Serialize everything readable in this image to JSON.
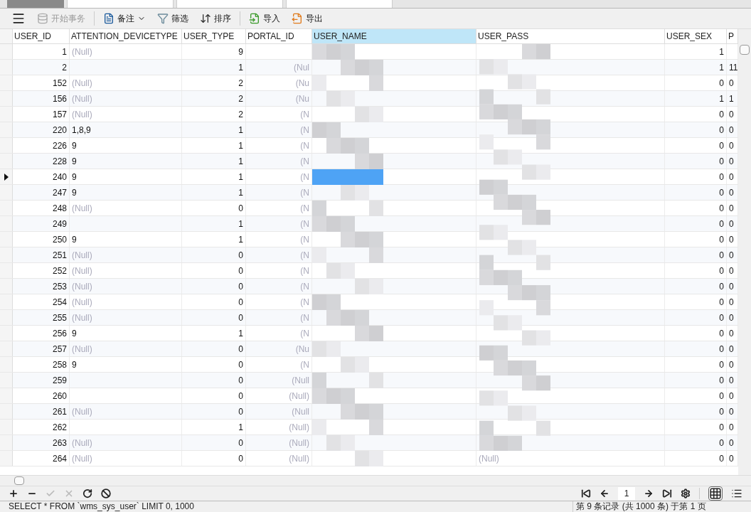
{
  "toolbar": {
    "buttons": [
      {
        "kind": "menu"
      },
      {
        "kind": "transaction",
        "label": "开始事务",
        "disabled": true
      },
      {
        "kind": "note",
        "label": "备注",
        "disabled": false
      },
      {
        "kind": "filter",
        "label": "筛选",
        "disabled": false
      },
      {
        "kind": "sort",
        "label": "排序",
        "disabled": false
      },
      {
        "kind": "import",
        "label": "导入",
        "disabled": false
      },
      {
        "kind": "export",
        "label": "导出",
        "disabled": false
      }
    ]
  },
  "table": {
    "columns": [
      {
        "label": "USER_ID",
        "kind": "number",
        "selected": false
      },
      {
        "label": "ATTENTION_DEVICETYPE",
        "kind": "text",
        "selected": false
      },
      {
        "label": "USER_TYPE",
        "kind": "number",
        "selected": false
      },
      {
        "label": "PORTAL_ID",
        "kind": "number",
        "selected": false
      },
      {
        "label": "USER_NAME",
        "kind": "text",
        "selected": true
      },
      {
        "label": "USER_PASS",
        "kind": "text",
        "selected": false
      },
      {
        "label": "USER_SEX",
        "kind": "number",
        "selected": false
      },
      {
        "label": "P",
        "kind": "text",
        "selected": false
      }
    ],
    "rows": [
      {
        "current": false,
        "cells": [
          "1",
          "(Null)",
          "9",
          "",
          "",
          "",
          "1",
          ""
        ]
      },
      {
        "current": false,
        "cells": [
          "2",
          "",
          "1",
          "(Nul",
          "",
          "",
          "1",
          "11"
        ]
      },
      {
        "current": false,
        "cells": [
          "152",
          "(Null)",
          "2",
          "(Nu",
          "",
          "",
          "0",
          "0"
        ]
      },
      {
        "current": false,
        "cells": [
          "156",
          "(Null)",
          "2",
          "(Nu",
          "",
          "",
          "1",
          "1"
        ]
      },
      {
        "current": false,
        "cells": [
          "157",
          "(Null)",
          "2",
          "(N",
          "",
          "",
          "0",
          "0"
        ]
      },
      {
        "current": false,
        "cells": [
          "220",
          "1,8,9",
          "1",
          "(N",
          "",
          "",
          "0",
          "0"
        ]
      },
      {
        "current": false,
        "cells": [
          "226",
          "9",
          "1",
          "(N",
          "",
          "",
          "0",
          "0"
        ]
      },
      {
        "current": false,
        "cells": [
          "228",
          "9",
          "1",
          "(N",
          "",
          "",
          "0",
          "0"
        ]
      },
      {
        "current": true,
        "cells": [
          "240",
          "9",
          "1",
          "(N",
          "",
          "",
          "0",
          "0"
        ]
      },
      {
        "current": false,
        "cells": [
          "247",
          "9",
          "1",
          "(N",
          "",
          "",
          "0",
          "0"
        ]
      },
      {
        "current": false,
        "cells": [
          "248",
          "(Null)",
          "0",
          "(N",
          "",
          "",
          "0",
          "0"
        ]
      },
      {
        "current": false,
        "cells": [
          "249",
          "",
          "1",
          "(N",
          "",
          "",
          "0",
          "0"
        ]
      },
      {
        "current": false,
        "cells": [
          "250",
          "9",
          "1",
          "(N",
          "",
          "",
          "0",
          "0"
        ]
      },
      {
        "current": false,
        "cells": [
          "251",
          "(Null)",
          "0",
          "(N",
          "",
          "",
          "0",
          "0"
        ]
      },
      {
        "current": false,
        "cells": [
          "252",
          "(Null)",
          "0",
          "(N",
          "",
          "",
          "0",
          "0"
        ]
      },
      {
        "current": false,
        "cells": [
          "253",
          "(Null)",
          "0",
          "(N",
          "",
          "",
          "0",
          "0"
        ]
      },
      {
        "current": false,
        "cells": [
          "254",
          "(Null)",
          "0",
          "(N",
          "",
          "",
          "0",
          "0"
        ]
      },
      {
        "current": false,
        "cells": [
          "255",
          "(Null)",
          "0",
          "(N",
          "",
          "",
          "0",
          "0"
        ]
      },
      {
        "current": false,
        "cells": [
          "256",
          "9",
          "1",
          "(N",
          "",
          "",
          "0",
          "0"
        ]
      },
      {
        "current": false,
        "cells": [
          "257",
          "(Null)",
          "0",
          "(Nu",
          "",
          "",
          "0",
          "0"
        ]
      },
      {
        "current": false,
        "cells": [
          "258",
          "9",
          "0",
          "(N",
          "",
          "",
          "0",
          "0"
        ]
      },
      {
        "current": false,
        "cells": [
          "259",
          "",
          "0",
          "(Null",
          "",
          "",
          "0",
          "0"
        ]
      },
      {
        "current": false,
        "cells": [
          "260",
          "",
          "0",
          "(Null)",
          "",
          "",
          "0",
          "0"
        ]
      },
      {
        "current": false,
        "cells": [
          "261",
          "(Null)",
          "0",
          "(Null",
          "",
          "",
          "0",
          "0"
        ]
      },
      {
        "current": false,
        "cells": [
          "262",
          "",
          "1",
          "(Null)",
          "",
          "",
          "0",
          "0"
        ]
      },
      {
        "current": false,
        "cells": [
          "263",
          "(Null)",
          "0",
          "(Null)",
          "",
          "",
          "0",
          "0"
        ]
      },
      {
        "current": false,
        "cells": [
          "264",
          "(Null)",
          "0",
          "(Null)",
          "",
          "(Null)",
          "0",
          "0"
        ]
      }
    ]
  },
  "pager": {
    "page": "1"
  },
  "status_bar": {
    "query": "SELECT * FROM `wms_sys_user` LIMIT 0, 1000",
    "record": "第 9 条记录 (共 1000 条) 于第 1 页"
  }
}
